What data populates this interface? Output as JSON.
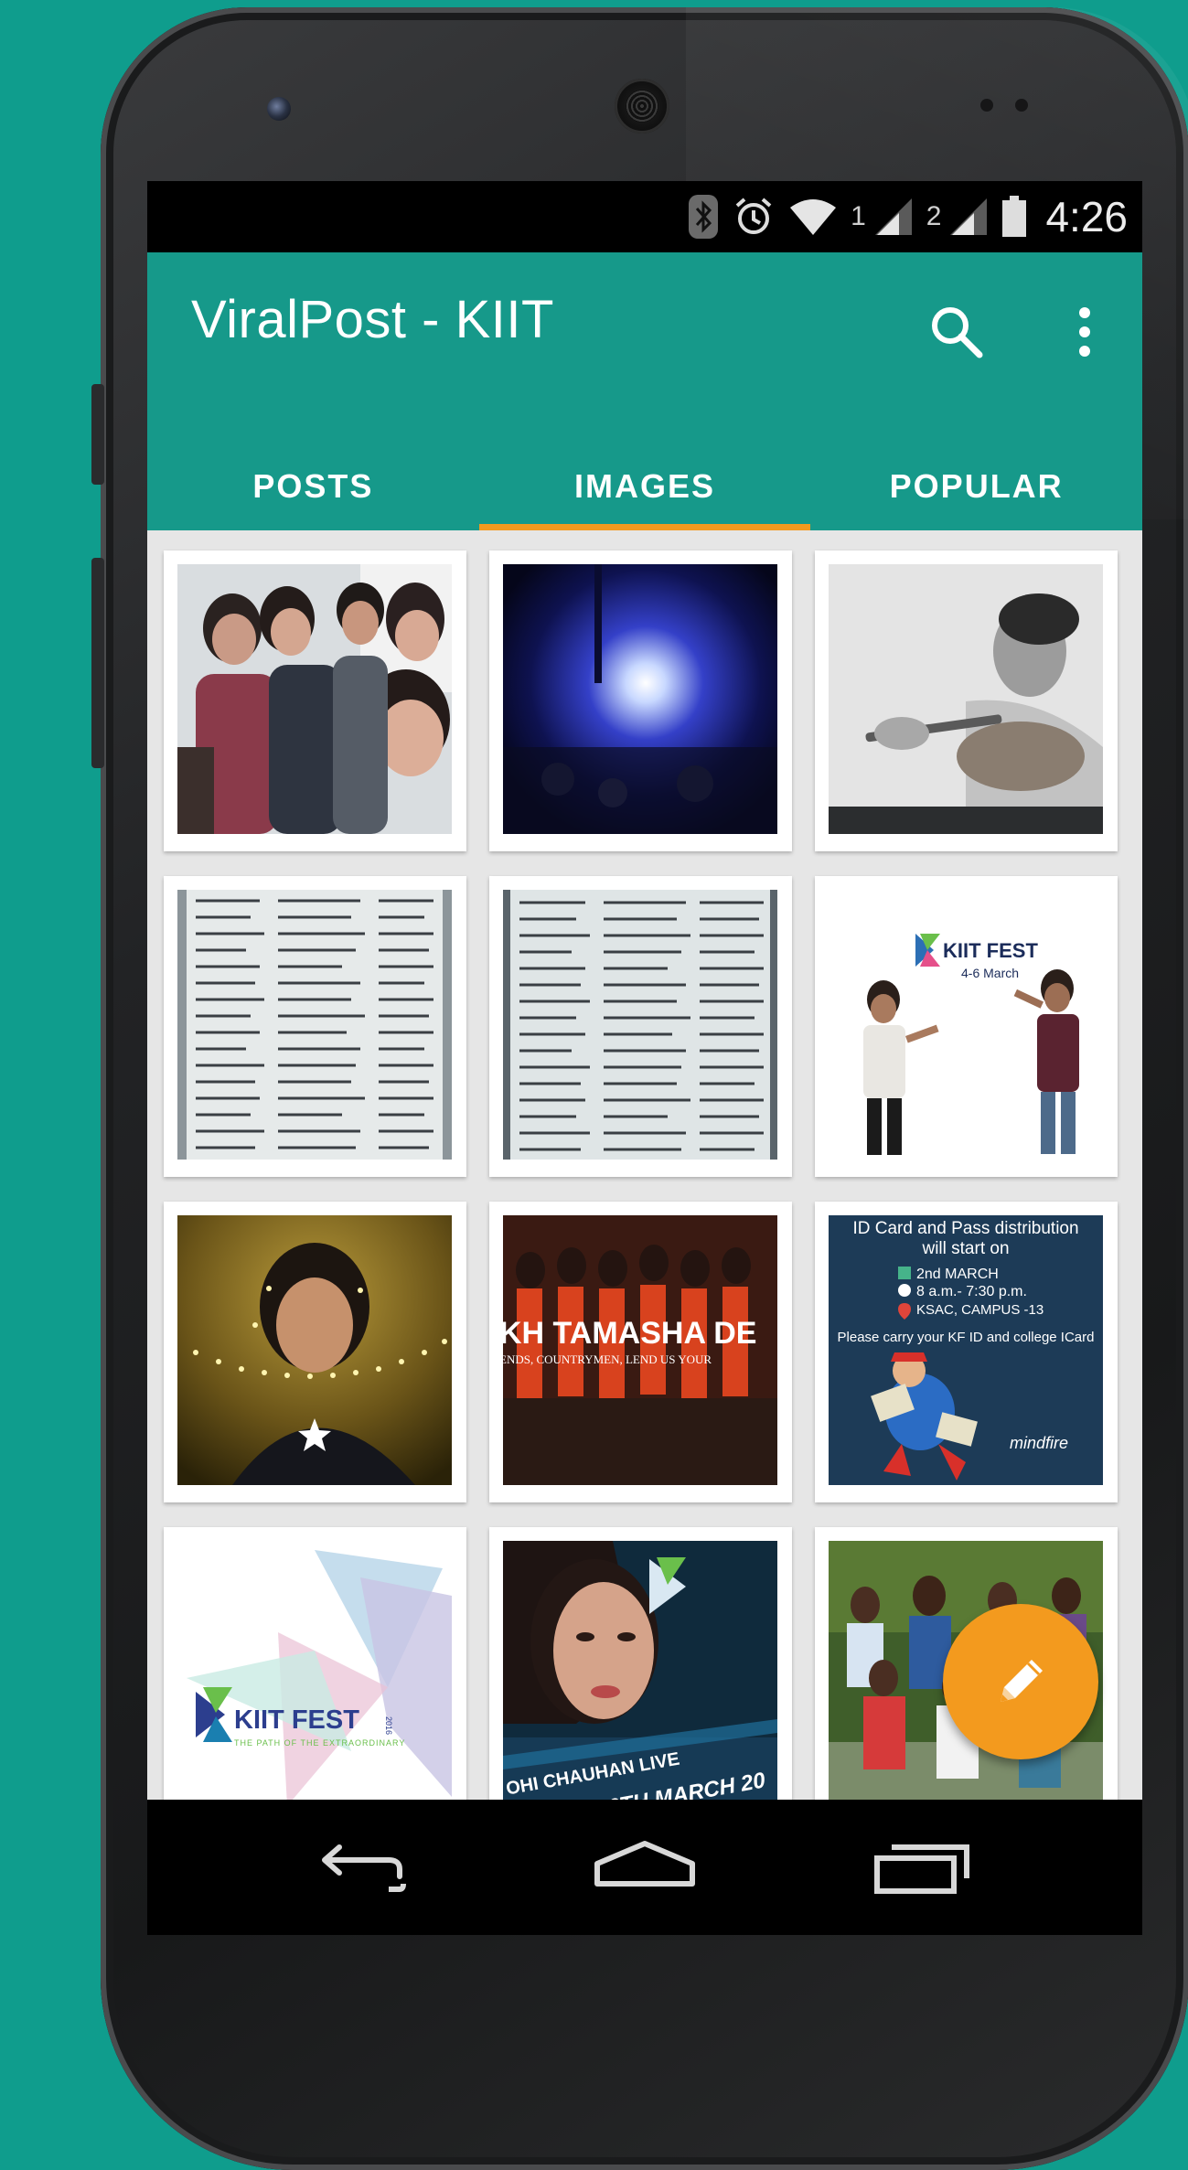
{
  "status_bar": {
    "time": "4:26",
    "sim1_label": "1",
    "sim2_label": "2",
    "icons": [
      "bluetooth-icon",
      "alarm-icon",
      "wifi-icon",
      "signal-icon",
      "signal-icon",
      "battery-icon"
    ]
  },
  "app_bar": {
    "title": "ViralPost - KIIT",
    "actions": [
      "search-icon",
      "more-vert-icon"
    ]
  },
  "tabs": [
    {
      "label": "POSTS",
      "active": false
    },
    {
      "label": "IMAGES",
      "active": true
    },
    {
      "label": "POPULAR",
      "active": false
    }
  ],
  "grid": {
    "items": [
      {
        "caption": ""
      },
      {
        "caption": ""
      },
      {
        "caption": ""
      },
      {
        "caption": ""
      },
      {
        "caption": ""
      },
      {
        "caption": "KIIT FEST",
        "sub": "4-6 March"
      },
      {
        "caption": ""
      },
      {
        "caption": "KH TAMASHA DE",
        "sub": "ENDS, COUNTRYMEN, LEND US YOUR"
      },
      {
        "line1": "ID Card and Pass distribution",
        "line2": "will start on",
        "line3": "2nd MARCH",
        "line4": "8 a.m.- 7:30 p.m.",
        "line5": "KSAC, CAMPUS -13",
        "line6": "Please carry your KF ID and college ICard",
        "brand": "mindfire"
      },
      {
        "caption": "KIIT FEST",
        "sub": "THE PATH OF THE EXTRAORDINARY",
        "year": "2016"
      },
      {
        "caption": "OHI CHAUHAN LIVE",
        "sub": "06TH MARCH 20"
      },
      {
        "caption": ""
      }
    ]
  },
  "fab": {
    "icon": "pencil-icon",
    "color": "#f39a1e"
  },
  "nav_bar": {
    "icons": [
      "back-icon",
      "home-icon",
      "recents-icon"
    ]
  },
  "colors": {
    "primary": "#16998a",
    "accent": "#f39a1e",
    "background": "#0f9d8d"
  }
}
